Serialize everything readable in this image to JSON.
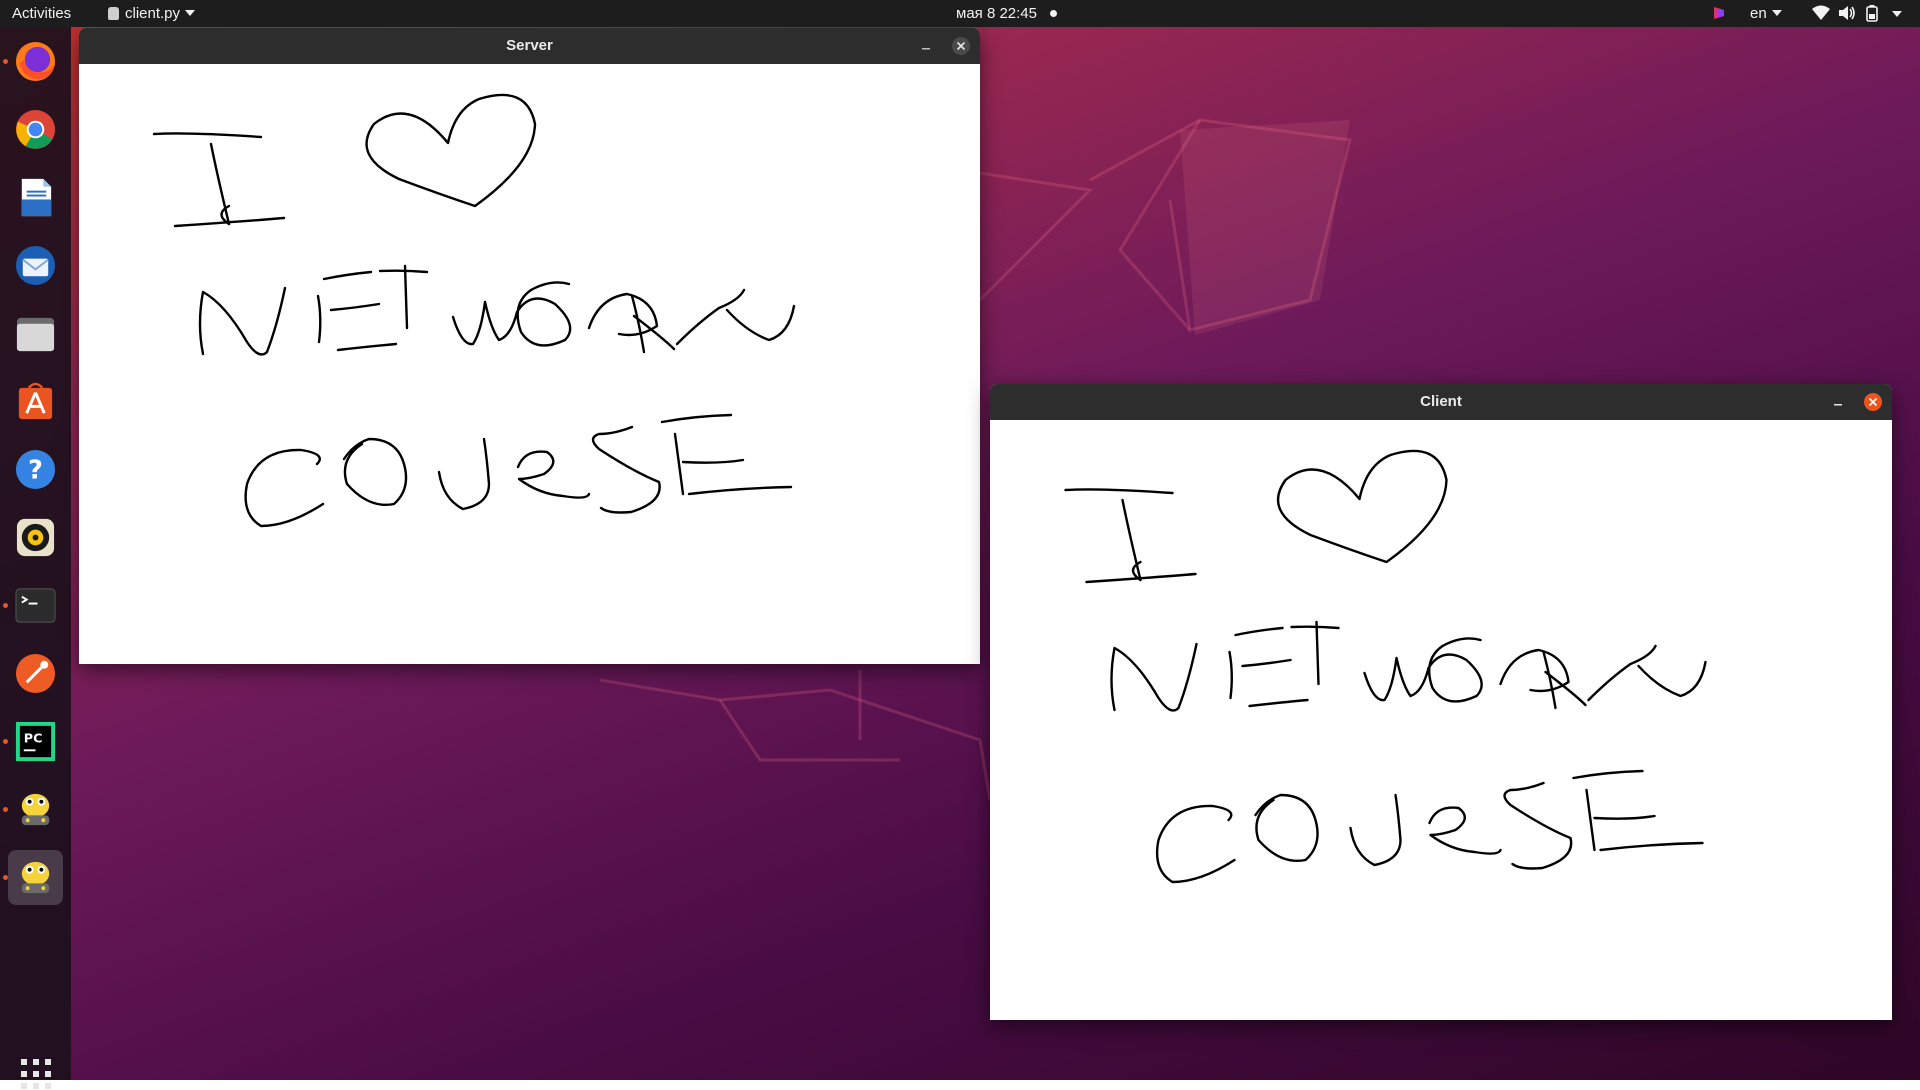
{
  "topbar": {
    "activities": "Activities",
    "app_menu": "client.py",
    "clock": "мая 8  22:45",
    "language": "en"
  },
  "dock": {
    "items": [
      {
        "name": "firefox",
        "running": true
      },
      {
        "name": "chrome",
        "running": false
      },
      {
        "name": "libreoffice-writer",
        "running": false
      },
      {
        "name": "thunderbird",
        "running": false
      },
      {
        "name": "files",
        "running": false
      },
      {
        "name": "ubuntu-software",
        "running": false
      },
      {
        "name": "help",
        "running": false
      },
      {
        "name": "rhythmbox",
        "running": false
      },
      {
        "name": "terminal",
        "running": true
      },
      {
        "name": "postman",
        "running": false
      },
      {
        "name": "pycharm",
        "running": true
      },
      {
        "name": "pygame-app",
        "running": true
      },
      {
        "name": "pygame-app-active",
        "running": true
      }
    ]
  },
  "windows": {
    "server": {
      "title": "Server"
    },
    "client": {
      "title": "Client",
      "focused": true
    }
  },
  "colors": {
    "accent": "#e95420",
    "topbar": "#1d1d1d",
    "titlebar": "#2d2d2d",
    "ink": "#000000"
  }
}
